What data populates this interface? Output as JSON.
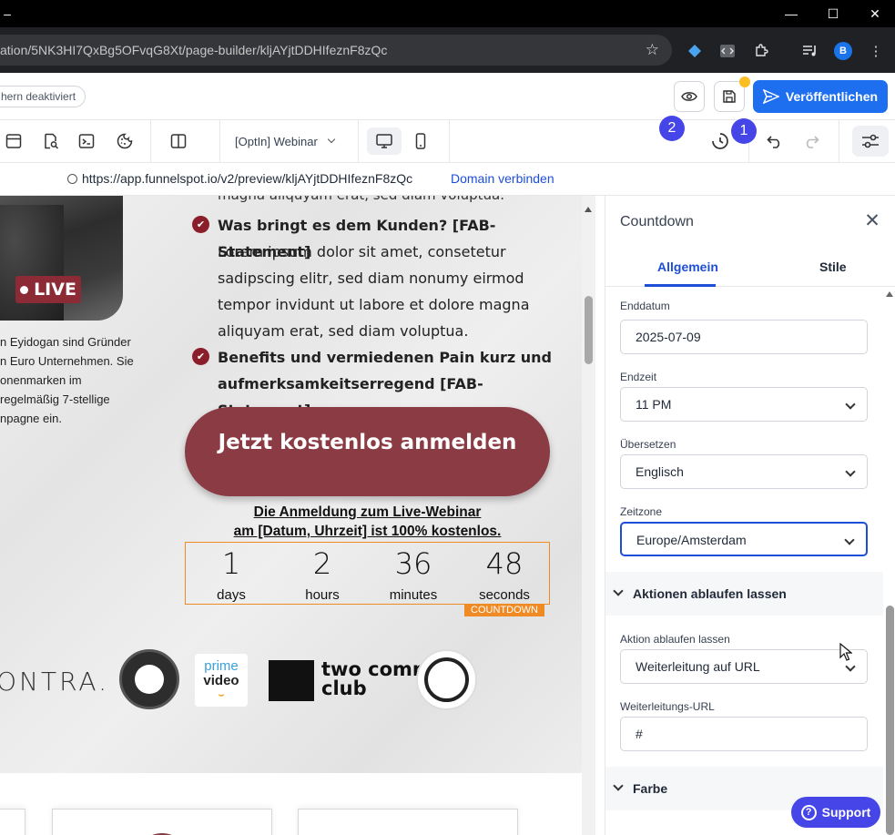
{
  "browser": {
    "url": "ation/5NK3HI7QxBg5OFvqG8Xt/page-builder/kljAYjtDDHIfeznF8zQc",
    "profile_initial": "B"
  },
  "header": {
    "status_text": "hern deaktiviert",
    "publish_label": "Veröffentlichen"
  },
  "toolbar": {
    "page_select": "[OptIn] Webinar",
    "badge_1": "1",
    "badge_2": "2"
  },
  "preview": {
    "url": "https://app.funnelspot.io/v2/preview/kljAYjtDDHIfeznF8zQc",
    "domain_link": "Domain verbinden"
  },
  "canvas": {
    "cut_line": "magna aliquyam erat, sed diam voluptua.",
    "live_label": "LIVE",
    "bio": [
      "n Eyidogan sind Gründer",
      "n Euro Unternehmen. Sie",
      "onenmarken im",
      "regelmäßig 7-stellige",
      "npagne ein."
    ],
    "bullets": [
      {
        "title": "Was bringt es dem Kunden? [FAB-Statement]",
        "body": [
          "Lorem ipsum dolor sit amet, consetetur",
          "sadipscing elitr, sed diam nonumy eirmod",
          "tempor invidunt ut labore et dolore magna",
          "aliquyam erat, sed diam voluptua."
        ]
      },
      {
        "title_lines": [
          "Benefits und vermiedenen Pain kurz und",
          "aufmerksamkeitserregend [FAB-Statement]"
        ]
      }
    ],
    "cta": "Jetzt kostenlos anmelden",
    "notice_lines": [
      "Die Anmeldung zum Live-Webinar",
      "am [Datum, Uhrzeit] ist 100% kostenlos."
    ],
    "countdown": [
      {
        "value": "1",
        "label": "days"
      },
      {
        "value": "2",
        "label": "hours"
      },
      {
        "value": "36",
        "label": "minutes"
      },
      {
        "value": "48",
        "label": "seconds"
      }
    ],
    "countdown_tag": "COUNTDOWN",
    "logos": {
      "ontra": "ONTRA.",
      "prime_line1": "prime",
      "prime_line2": "video",
      "twocomma_line1": "two comma",
      "twocomma_line2": "club"
    }
  },
  "panel": {
    "title": "Countdown",
    "tabs": [
      "Allgemein",
      "Stile"
    ],
    "fields": {
      "enddatum_label": "Enddatum",
      "enddatum_value": "2025-07-09",
      "endzeit_label": "Endzeit",
      "endzeit_value": "11 PM",
      "uebersetzen_label": "Übersetzen",
      "uebersetzen_value": "Englisch",
      "zeitzone_label": "Zeitzone",
      "zeitzone_value": "Europe/Amsterdam"
    },
    "section_actions": "Aktionen ablaufen lassen",
    "aktion_label": "Aktion ablaufen lassen",
    "aktion_value": "Weiterleitung auf URL",
    "url_label": "Weiterleitungs-URL",
    "url_value": "#",
    "section_color": "Farbe"
  },
  "support_label": "Support",
  "colors": {
    "accent": "#1d6ff0",
    "badge": "#4545e8",
    "cta": "#8b3b44",
    "countdown_border": "#f08a24"
  }
}
